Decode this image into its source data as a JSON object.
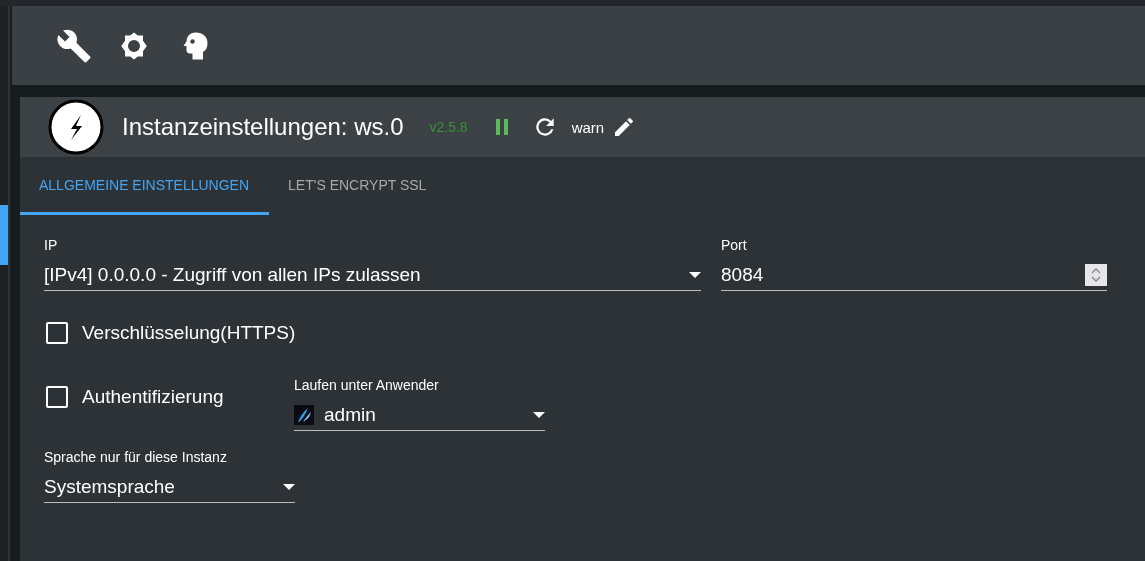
{
  "header": {
    "title": "Instanzeinstellungen: ws.0",
    "version": "v2.5.8",
    "log_level": "warn"
  },
  "tabs": [
    {
      "label": "ALLGEMEINE EINSTELLUNGEN",
      "selected": true
    },
    {
      "label": "LET'S ENCRYPT SSL",
      "selected": false
    }
  ],
  "rows": [
    {
      "fields": [
        {
          "kind": "select",
          "label": "IP",
          "value": "[IPv4] 0.0.0.0 - Zugriff von allen IPs zulassen"
        },
        {
          "kind": "number",
          "label": "Port",
          "value": "8084"
        }
      ]
    },
    {
      "fields": [
        {
          "kind": "checkbox",
          "label": "Verschlüsselung(HTTPS)",
          "checked": false
        }
      ]
    },
    {
      "fields": [
        {
          "kind": "checkbox",
          "label": "Authentifizierung",
          "checked": false
        },
        {
          "kind": "user",
          "label": "Laufen unter Anwender",
          "value": "admin"
        }
      ]
    },
    {
      "fields": [
        {
          "kind": "select",
          "label": "Sprache nur für diese Instanz",
          "value": "Systemsprache"
        }
      ]
    }
  ]
}
